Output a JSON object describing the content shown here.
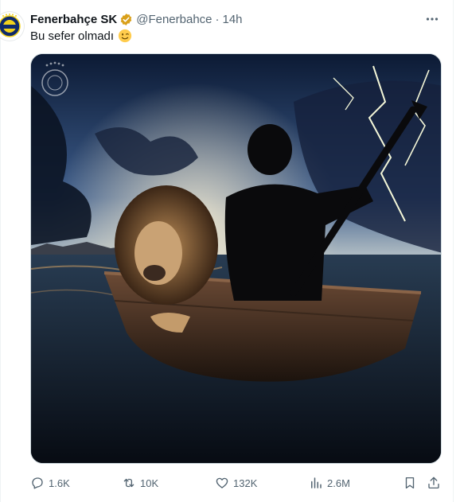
{
  "tweet": {
    "author_name": "Fenerbahçe SK",
    "handle": "@Fenerbahce",
    "separator": "·",
    "time": "14h",
    "text": "Bu sefer olmadı",
    "emoji": "winking-face"
  },
  "media": {
    "description_icons": [
      "club-crest-watermark"
    ]
  },
  "actions": {
    "replies": "1.6K",
    "reposts": "10K",
    "likes": "132K",
    "views": "2.6M"
  },
  "colors": {
    "verified": "#d9a01a",
    "muted": "#536471",
    "text": "#0f1419"
  }
}
